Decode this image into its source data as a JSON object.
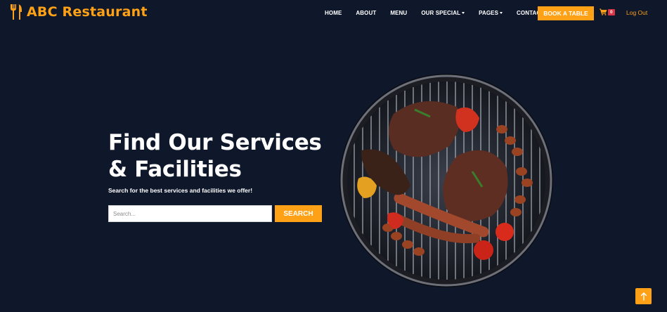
{
  "brand": {
    "name": "ABC Restaurant",
    "icon": "utensils-icon"
  },
  "nav": {
    "links": [
      {
        "label": "HOME",
        "dropdown": false
      },
      {
        "label": "ABOUT",
        "dropdown": false
      },
      {
        "label": "MENU",
        "dropdown": false
      },
      {
        "label": "OUR SPECIAL",
        "dropdown": true
      },
      {
        "label": "PAGES",
        "dropdown": true
      },
      {
        "label": "CONTACT",
        "dropdown": false
      }
    ],
    "book_label": "BOOK A TABLE",
    "cart_count": "0",
    "logout_label": "Log Out"
  },
  "hero": {
    "title": "Find Our Services & Facilities",
    "subtitle": "Search for the best services and facilities we offer!",
    "search_placeholder": "Search...",
    "search_button": "SEARCH",
    "image": "grilled-food-image"
  },
  "colors": {
    "background": "#0f172b",
    "accent": "#fea116",
    "badge": "#dc3545"
  }
}
